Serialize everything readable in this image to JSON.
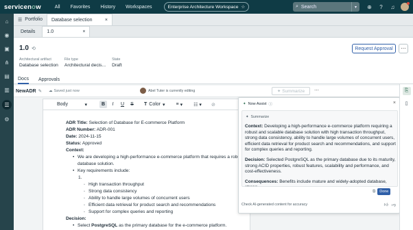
{
  "app": {
    "logo": "servicenow",
    "nav": [
      "All",
      "Favorites",
      "History",
      "Workspaces"
    ],
    "workspace_pill": "Enterprise Architecture Workspace",
    "search_label": "Search"
  },
  "tabs_row1": [
    {
      "label": "Portfolio"
    },
    {
      "label": "Database selection",
      "active": true
    }
  ],
  "tabs_row2": [
    {
      "label": "Details"
    },
    {
      "label": "1.0",
      "active": true
    }
  ],
  "record": {
    "version": "1.0",
    "fields": [
      {
        "key": "Architectural artifact",
        "value": "Database selection"
      },
      {
        "key": "File type",
        "value": "Architectural decis..."
      },
      {
        "key": "State",
        "value": "Draft"
      }
    ],
    "request_approval_label": "Request Approval"
  },
  "subtabs": [
    "Docs",
    "Approvals"
  ],
  "docbar": {
    "name": "NewADR",
    "saved": "Saved just now",
    "editing": "Abel Tuter is currently editing",
    "summarize_label": "Summarize"
  },
  "format": {
    "style": "Body",
    "color": "Color"
  },
  "document": {
    "title_k": "ADR Title:",
    "title_v": " Selection of Database for E-commerce Platform",
    "number_k": "ADR Number:",
    "number_v": " ADR-001",
    "date_k": "Date:",
    "date_v": " 2024-11-15",
    "status_k": "Status:",
    "status_v": " Approved",
    "context_k": "Context:",
    "context_b1": "We are developing a high-performance e-commerce platform that requires a robust and",
    "context_b1b": "database solution.",
    "context_b2": "Key requirements include:",
    "num1": "1.",
    "reqs": [
      "High transaction throughput",
      "Strong data consistency",
      "Ability to handle large volumes of concurrent users",
      "Efficient data retrieval for product search and recommendations",
      "Support for complex queries and reporting"
    ],
    "decision_k": "Decision:",
    "decision_b1a": "Select ",
    "decision_b1b": "PostgreSQL",
    "decision_b1c": " as the primary database for the e-commerce platform."
  },
  "assist": {
    "title": "Now Assist",
    "summarize": "Summarize",
    "context_k": "Context:",
    "context_v": " Developing a high-performance e-commerce platform requiring a robust and scalable database solution with high transaction throughput, strong data consistency, ability to handle large volumes of concurrent users, efficient data retrieval for product search and recommendations, and support for complex queries and reporting.",
    "decision_k": "Decision:",
    "decision_v": " Selected PostgreSQL as the primary database due to its maturity, strong ACID properties, robust features, scalability and performance, and cost-effectiveness.",
    "consequences_k": "Consequences:",
    "consequences_v": " Benefits include mature and widely-adopted database, strong",
    "done_label": "Done",
    "footer": "Check AI-generated content for accuracy"
  },
  "colors": {
    "topbar": "#0f3b45",
    "rail": "#26444b",
    "accent": "#2f5fa8"
  }
}
